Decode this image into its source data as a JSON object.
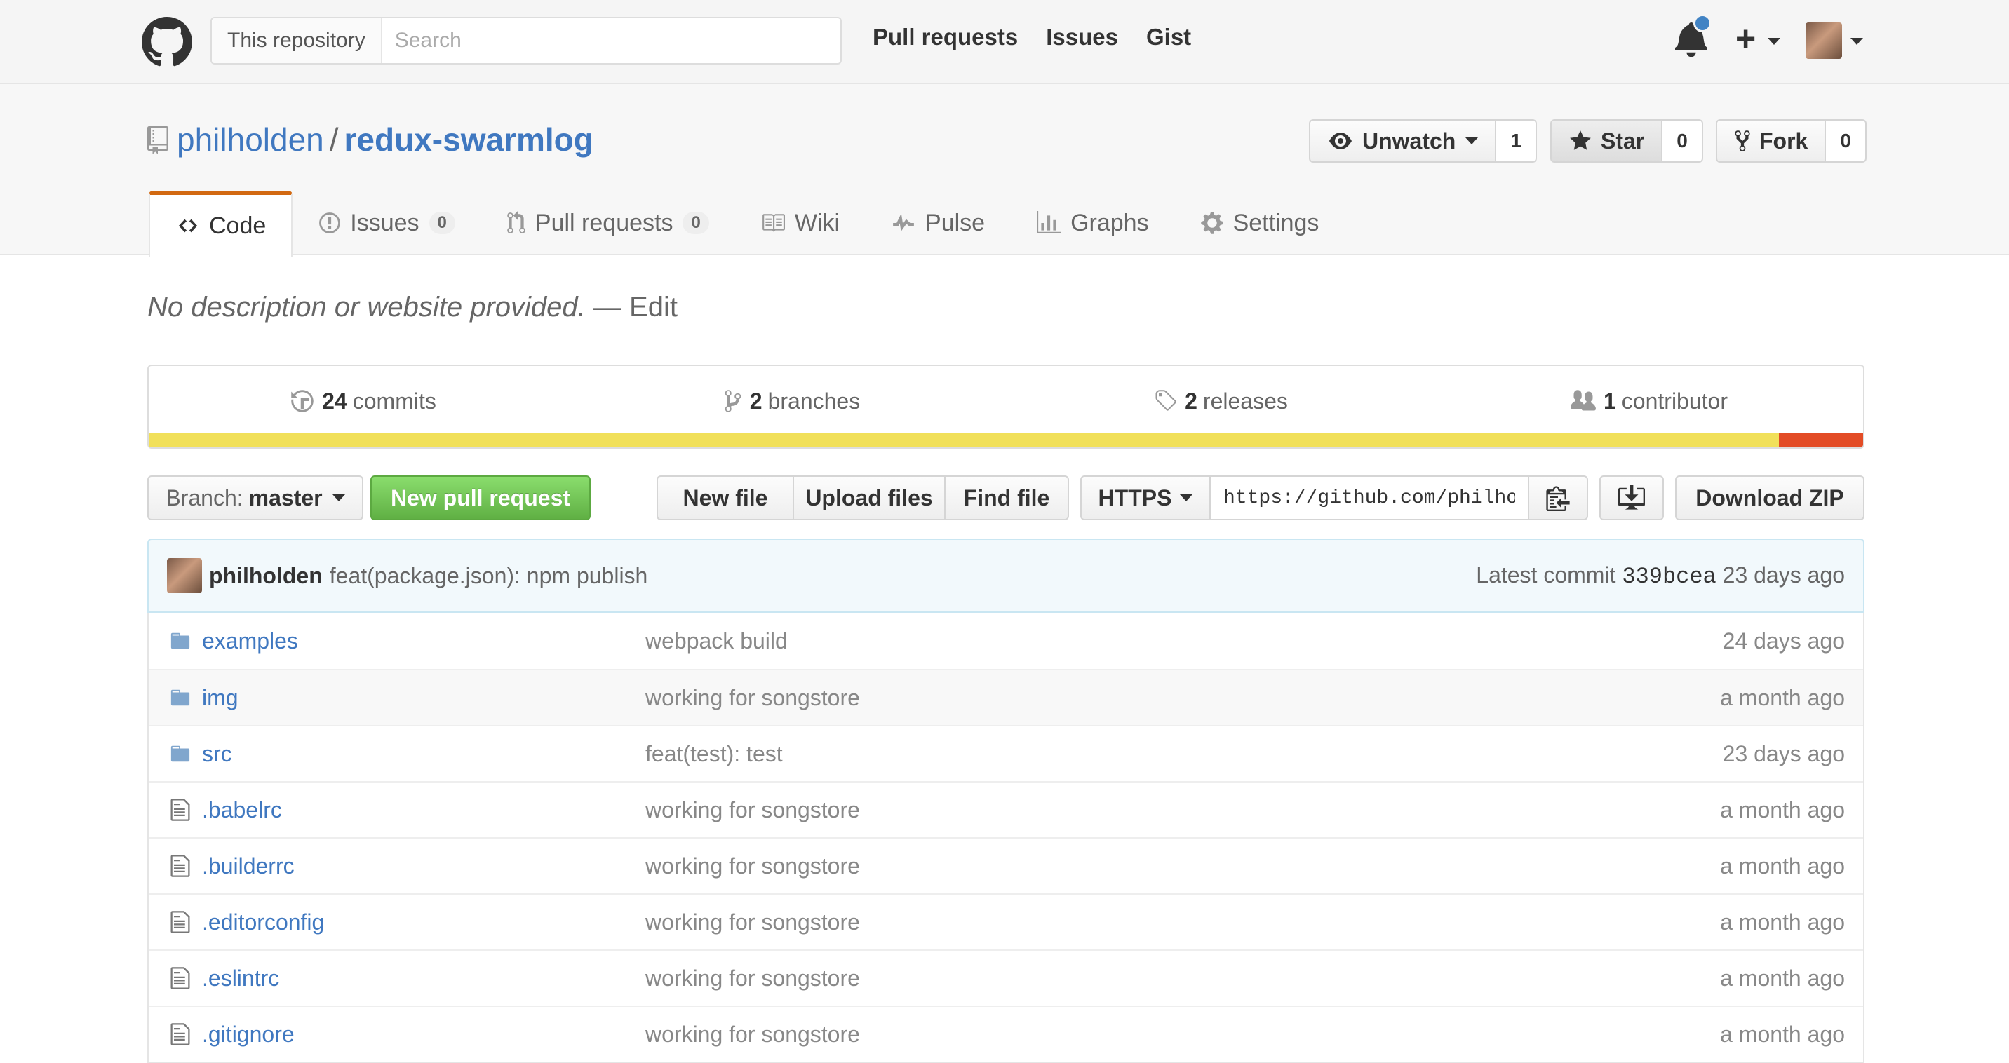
{
  "header": {
    "search_scope": "This repository",
    "search_placeholder": "Search",
    "nav": [
      "Pull requests",
      "Issues",
      "Gist"
    ]
  },
  "repo": {
    "owner": "philholden",
    "separator": "/",
    "name": "redux-swarmlog",
    "watch_label": "Unwatch",
    "watch_count": "1",
    "star_label": "Star",
    "star_count": "0",
    "fork_label": "Fork",
    "fork_count": "0"
  },
  "tabs": {
    "code": "Code",
    "issues": "Issues",
    "issues_count": "0",
    "pulls": "Pull requests",
    "pulls_count": "0",
    "wiki": "Wiki",
    "pulse": "Pulse",
    "graphs": "Graphs",
    "settings": "Settings"
  },
  "description": {
    "text": "No description or website provided.",
    "dash": "—",
    "edit": "Edit"
  },
  "summary": {
    "commits_count": "24",
    "commits_label": "commits",
    "branches_count": "2",
    "branches_label": "branches",
    "releases_count": "2",
    "releases_label": "releases",
    "contributors_count": "1",
    "contributors_label": "contributor"
  },
  "languages": [
    {
      "color": "#f1e05a",
      "percent": 95.1
    },
    {
      "color": "#e34c26",
      "percent": 4.9
    }
  ],
  "filenav": {
    "branch_prefix": "Branch:",
    "branch_name": "master",
    "new_pr": "New pull request",
    "new_file": "New file",
    "upload_files": "Upload files",
    "find_file": "Find file",
    "protocol": "HTTPS",
    "clone_url": "https://github.com/philho",
    "download_zip": "Download ZIP"
  },
  "latest_commit": {
    "author": "philholden",
    "message": "feat(package.json): npm publish",
    "label": "Latest commit",
    "sha": "339bcea",
    "age": "23 days ago"
  },
  "files": [
    {
      "type": "dir",
      "name": "examples",
      "message": "webpack build",
      "age": "24 days ago"
    },
    {
      "type": "dir",
      "name": "img",
      "message": "working for songstore",
      "age": "a month ago"
    },
    {
      "type": "dir",
      "name": "src",
      "message": "feat(test): test",
      "age": "23 days ago"
    },
    {
      "type": "file",
      "name": ".babelrc",
      "message": "working for songstore",
      "age": "a month ago"
    },
    {
      "type": "file",
      "name": ".builderrc",
      "message": "working for songstore",
      "age": "a month ago"
    },
    {
      "type": "file",
      "name": ".editorconfig",
      "message": "working for songstore",
      "age": "a month ago"
    },
    {
      "type": "file",
      "name": ".eslintrc",
      "message": "working for songstore",
      "age": "a month ago"
    },
    {
      "type": "file",
      "name": ".gitignore",
      "message": "working for songstore",
      "age": "a month ago"
    }
  ]
}
